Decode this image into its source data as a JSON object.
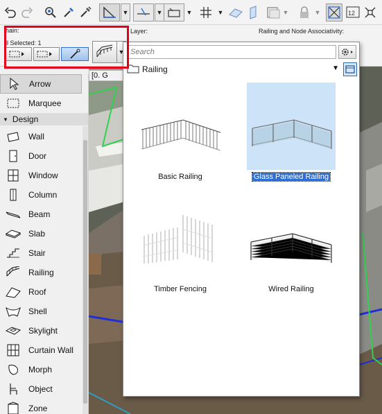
{
  "info_box": {
    "layer_label": "Layer:",
    "railing_node_label": "Railing and Node Associativity:",
    "chain_label": "hain:",
    "selected_label": "ll Selected: 1"
  },
  "tool_palette": {
    "arrow": "Arrow",
    "marquee": "Marquee",
    "design_header": "Design",
    "items": [
      "Wall",
      "Door",
      "Window",
      "Column",
      "Beam",
      "Slab",
      "Stair",
      "Railing",
      "Roof",
      "Shell",
      "Skylight",
      "Curtain Wall",
      "Morph",
      "Object",
      "Zone"
    ]
  },
  "viewport": {
    "story_tab": "[0. G"
  },
  "settings_popup": {
    "search_placeholder": "Search",
    "folder": "Railing",
    "items": [
      {
        "label": "Basic Railing",
        "selected": false
      },
      {
        "label": "Glass Paneled Railing",
        "selected": true
      },
      {
        "label": "Timber Fencing",
        "selected": false
      },
      {
        "label": "Wired Railing",
        "selected": false
      }
    ]
  },
  "colors": {
    "highlight_frame": "#e3001b",
    "selection_blue": "#2f6fd1",
    "selected_thumb_bg": "#cde3f7"
  }
}
